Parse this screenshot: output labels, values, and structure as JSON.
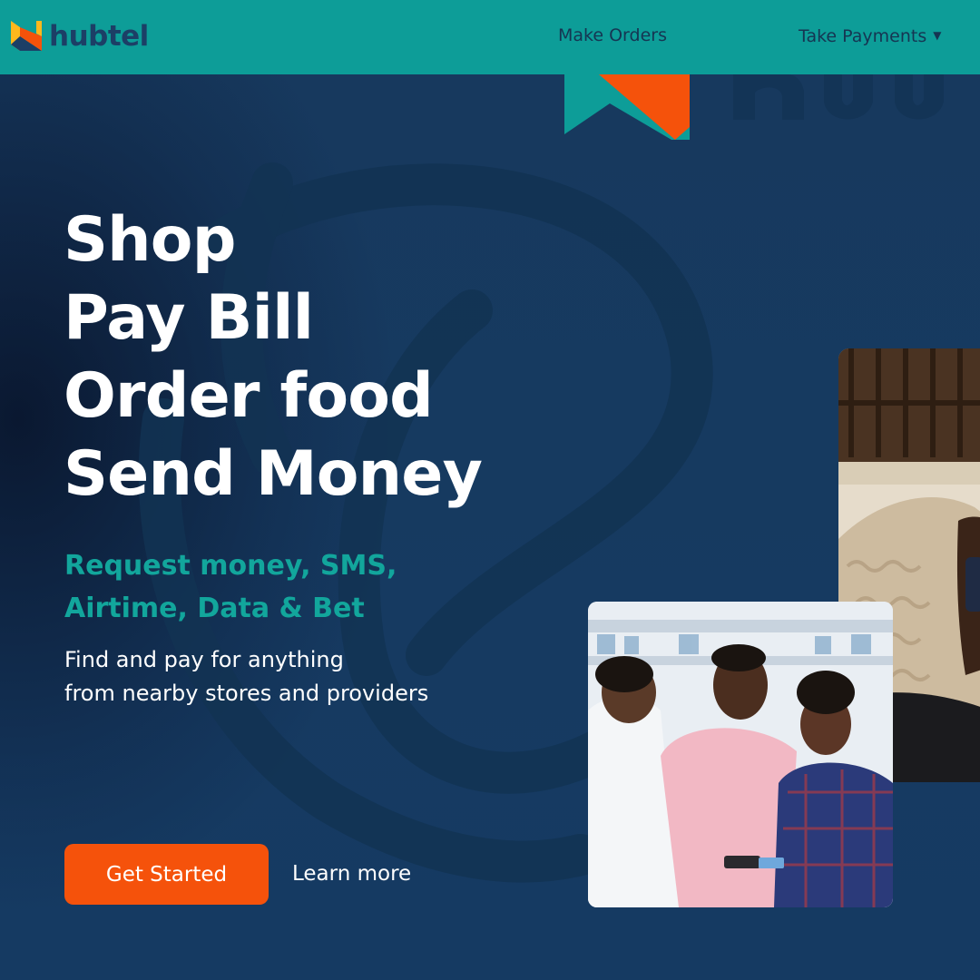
{
  "colors": {
    "navbar_bg": "#0d9d98",
    "hero_bg": "#163b60",
    "accent_teal": "#12a69c",
    "accent_orange": "#f5520b",
    "text_white": "#ffffff",
    "brand_navy": "#1c3f66"
  },
  "navbar": {
    "logo_icon": "hubtel-logo-icon",
    "brand_name": "hubtel",
    "links": [
      {
        "label": "Make Orders",
        "has_dropdown": false
      },
      {
        "label": "Take Payments",
        "has_dropdown": true,
        "dropdown_icon": "caret-down-icon"
      }
    ]
  },
  "hero": {
    "headline_lines": [
      "Shop",
      "Pay Bill",
      "Order food",
      "Send Money"
    ],
    "subheading_lines": [
      "Request money, SMS,",
      "Airtime, Data & Bet"
    ],
    "description_lines": [
      "Find and pay for anything",
      "from nearby stores and providers"
    ],
    "primary_button": "Get Started",
    "secondary_link": "Learn more",
    "background_watermark": "hubtel-logo-watermark",
    "images": [
      {
        "name": "pharmacy-customers-photo",
        "subject": "three people at a pharmacy counter paying by card"
      },
      {
        "name": "woman-with-phone-photo",
        "subject": "woman in a knit cardigan holding a phone"
      }
    ]
  }
}
